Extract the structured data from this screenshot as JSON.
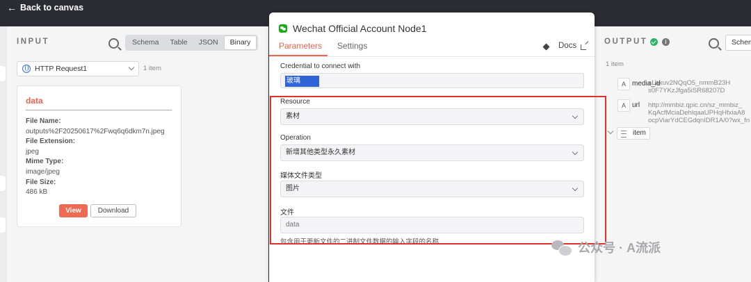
{
  "back_link": "Back to canvas",
  "input": {
    "title": "INPUT",
    "tabs": [
      "Schema",
      "Table",
      "JSON",
      "Binary"
    ],
    "active_tab": "Binary",
    "source_select": "HTTP Request1",
    "item_count": "1 item",
    "card": {
      "title": "data",
      "fields": [
        {
          "key": "File Name:",
          "value": "outputs%2F20250617%2Fwq6q6dkm7n.jpeg"
        },
        {
          "key": "File Extension:",
          "value": "jpeg"
        },
        {
          "key": "Mime Type:",
          "value": "image/jpeg"
        },
        {
          "key": "File Size:",
          "value": "486 kB"
        }
      ],
      "view_label": "View",
      "download_label": "Download"
    }
  },
  "node": {
    "title": "Wechat Official Account Node1",
    "tabs": [
      "Parameters",
      "Settings"
    ],
    "active_tab": "Parameters",
    "docs_label": "Docs",
    "credential_label": "Credential to connect with",
    "credential_value": "玻璃",
    "resource_label": "Resource",
    "resource_value": "素材",
    "operation_label": "Operation",
    "operation_value": "新增其他类型永久素材",
    "media_type_label": "媒体文件类型",
    "media_type_value": "图片",
    "file_label": "文件",
    "file_value": "data",
    "file_hint": "包含用于更新文件的二进制文件数据的输入字段的名称"
  },
  "output": {
    "title": "OUTPUT",
    "tab": "Schem",
    "item_count": "1 item",
    "rows": [
      {
        "type": "A",
        "key": "media_id",
        "value_lines": [
          "aLakuv2NQqO5_nmmB23H",
          "s0F7YKzJfga5iSR68207D"
        ]
      },
      {
        "type": "A",
        "key": "url",
        "value_lines": [
          "http://mmbiz.qpic.cn/sz_mmbiz_",
          "KqAcfMciaDehlqaaUPHqHfxiaA8",
          "ocpViarYdCEGdqnIDR1A/0?wx_fn"
        ]
      }
    ],
    "item_label": "item"
  },
  "watermark": "公众号 · A流派",
  "colors": {
    "accent": "#e8644b",
    "highlight_box": "#e0302b",
    "success": "#2fb36b",
    "wechat": "#1aad19"
  }
}
